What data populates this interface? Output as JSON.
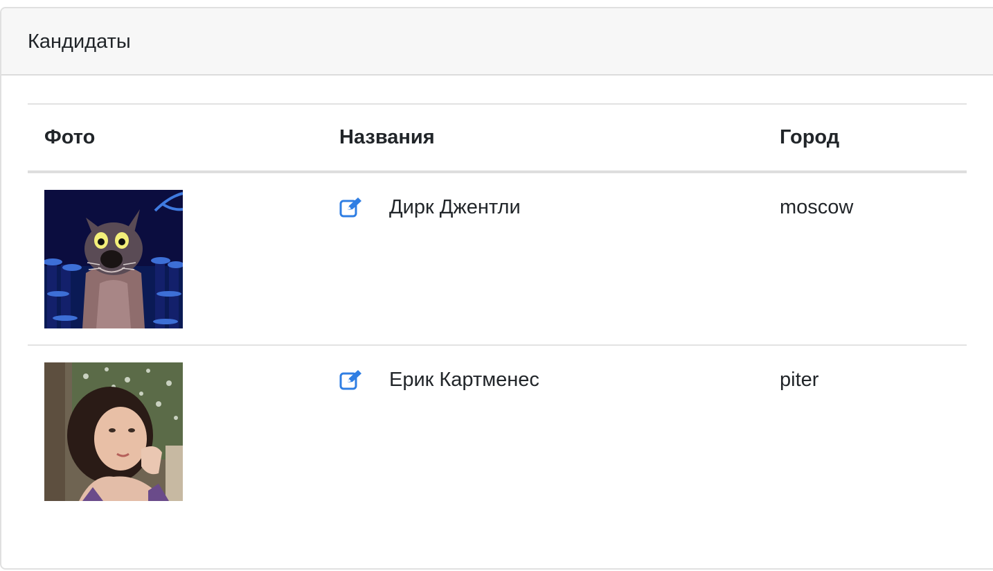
{
  "card": {
    "title": "Кандидаты"
  },
  "table": {
    "columns": [
      "Фото",
      "Названия",
      "Город"
    ],
    "rows": [
      {
        "photo": "wolf-cartoon-photo",
        "name": "Дирк Джентли",
        "city": "moscow",
        "edit_icon": "edit-icon"
      },
      {
        "photo": "woman-portrait-photo",
        "name": "Ерик Картменес",
        "city": "piter",
        "edit_icon": "edit-icon"
      }
    ]
  },
  "colors": {
    "accent": "#2f7ee3",
    "header_bg": "#f7f7f7",
    "text": "#212529"
  }
}
